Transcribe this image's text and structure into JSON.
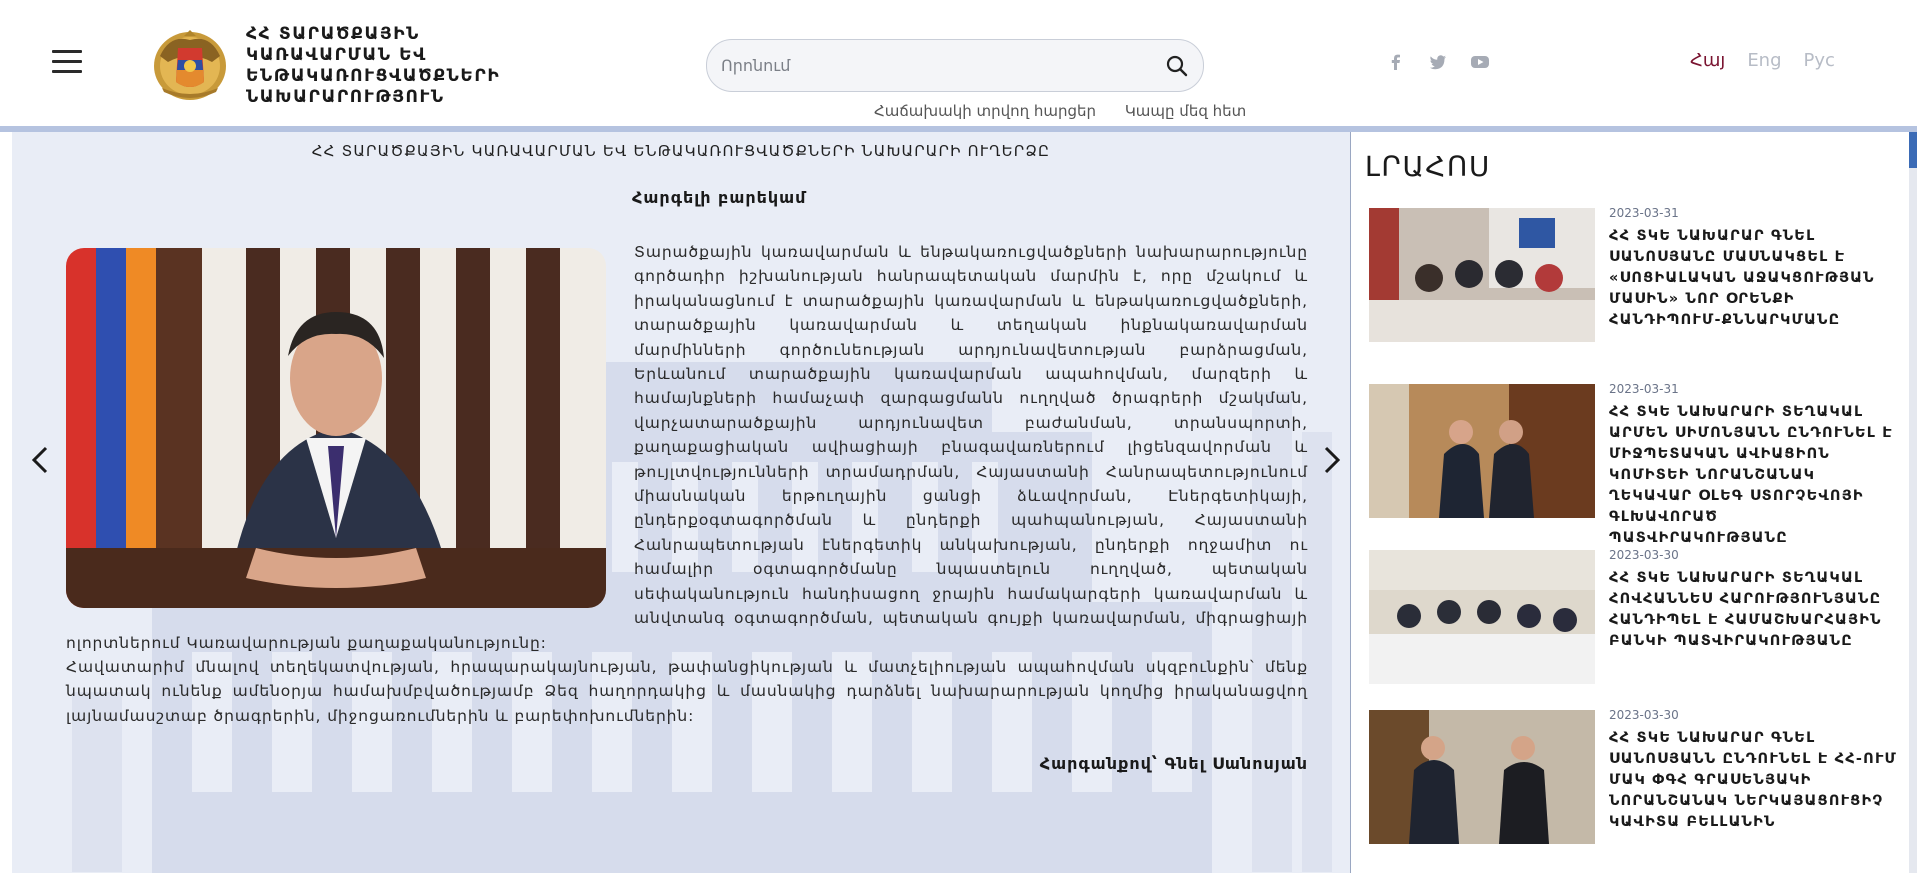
{
  "header": {
    "ministry_title": "ՀՀ ՏԱՐԱԾՔԱՅԻՆ ԿԱՌԱՎԱՐՄԱՆ ԵՎ ԵՆԹԱԿԱՌՈՒՑՎԱԾՔՆԵՐԻ ՆԱԽԱՐԱՐՈՒԹՅՈՒՆ",
    "search_placeholder": "Որոնում",
    "links": {
      "faq": "Հաճախակի տրվող հարցեր",
      "contact": "Կապը մեզ հետ"
    },
    "social_icons": [
      "facebook-icon",
      "twitter-icon",
      "youtube-icon"
    ],
    "languages": [
      {
        "label": "Հայ",
        "active": true
      },
      {
        "label": "Eng",
        "active": false
      },
      {
        "label": "Рус",
        "active": false
      }
    ]
  },
  "main": {
    "title": "ՀՀ ՏԱՐԱԾՔԱՅԻՆ ԿԱՌԱՎԱՐՄԱՆ ԵՎ ԵՆԹԱԿԱՌՈՒՑՎԱԾՔՆԵՐԻ ՆԱԽԱՐԱՐԻ ՈՒՂԵՐՁԸ",
    "greeting": "Հարգելի բարեկամ",
    "paragraph1": "Տարածքային կառավարման և ենթակառուցվածքների նախարարությունը գործադիր իշխանության հանրապետական մարմին է, որը մշակում և իրականացնում է տարածքային կառավարման և ենթակառուցվածքների, տարածքային կառավարման և տեղական ինքնակառավարման մարմինների գործունեության արդյունավետության բարձրացման, Երևանում տարածքային կառավարման ապահովման, մարզերի և համայնքների համաչափ զարգացմանն ուղղված ծրագրերի մշակման, վարչատարածքային արդյունավետ բաժանման, տրանսպորտի, քաղաքացիական ավիացիայի բնագավառներում լիցենզավորման և թույլտվությունների տրամադրման, Հայաստանի Հանրապետությունում միասնական երթուղային ցանցի ձևավորման, Էներգետիկայի, ընդերքօգտագործման և ընդերքի պահպանության, Հայաստանի Հանրապետության էներգետիկ անկախության, ընդերքի ողջամիտ ու համալիր օգտագործմանը նպաստելուն ուղղված, պետական սեփականություն հանդիսացող ջրային համակարգերի կառավարման և անվտանգ օգտագործման, պետական գույքի կառավարման, միգրացիայի ոլորտներում Կառավարության քաղաքականությունը:",
    "paragraph2": "Հավատարիմ մնալով տեղեկատվության, հրապարակայնության, թափանցիկության և մատչելիության ապահովման սկզբունքին՝ մենք նպատակ ունենք ամենօրյա համախմբվածությամբ Ձեզ հաղորդակից և մասնակից դարձնել նախարարության կողմից իրականացվող լայնամասշտաբ ծրագրերին, միջոցառումներին և բարեփոխումներին:",
    "signature": "Հարգանքով՝ Գնել Սանոսյան"
  },
  "news": {
    "title": "ԼՐԱՀՈՍ",
    "items": [
      {
        "date": "2023-03-31",
        "headline": "ՀՀ ՏԿԵ ՆԱԽԱՐԱՐ ԳՆԵԼ ՍԱՆՈՍՅԱՆԸ ՄԱՍՆԱԿՑԵԼ Է «ՍՈՑԻԱԼԱԿԱՆ ԱՋԱԿՑՈՒԹՅԱՆ ՄԱՍԻՆ» ՆՈՐ ՕՐԵՆՔԻ ՀԱՆԴԻՊՈՒՄ-ՔՆՆԱՐԿՄԱՆԸ"
      },
      {
        "date": "2023-03-31",
        "headline": "ՀՀ ՏԿԵ ՆԱԽԱՐԱՐԻ ՏԵՂԱԿԱԼ ԱՐՄԵՆ ՍԻՄՈՆՅԱՆՆ ԸՆԴՈՒՆԵԼ Է ՄԻՋՊԵՏԱԿԱՆ ԱՎԻԱՑԻՈՆ ԿՈՄԻՏԵԻ ՆՈՐԱՆՇԱՆԱԿ ՂԵԿԱՎԱՐ ՕԼԵԳ ՍՏՈՐՉԵՎՈՅԻ ԳԼԽԱՎՈՐԱԾ ՊԱՏՎԻՐԱԿՈՒԹՅԱՆԸ"
      },
      {
        "date": "2023-03-30",
        "headline": "ՀՀ ՏԿԵ ՆԱԽԱՐԱՐԻ ՏԵՂԱԿԱԼ ՀՈՎՀԱՆՆԵՍ ՀԱՐՈՒԹՅՈՒՆՅԱՆԸ ՀԱՆԴԻՊԵԼ Է ՀԱՄԱՇԽԱՐՀԱՅԻՆ ԲԱՆԿԻ ՊԱՏՎԻՐԱԿՈՒԹՅԱՆԸ"
      },
      {
        "date": "2023-03-30",
        "headline": "ՀՀ ՏԿԵ ՆԱԽԱՐԱՐ ԳՆԵԼ ՍԱՆՈՍՅԱՆՆ ԸՆԴՈՒՆԵԼ Է ՀՀ-ՈՒՄ ՄԱԿ ՓԳՀ ԳՐԱՍԵՆՅԱԿԻ ՆՈՐԱՆՇԱՆԱԿ ՆԵՐԿԱՅԱՑՈՒՑԻՉ ԿԱՎԻՏԱ ԲԵԼԼԱՆԻՆ"
      }
    ]
  },
  "colors": {
    "accent": "#7a1330",
    "band": "#b5c3e0",
    "main_bg": "#e9edf6",
    "scroll_thumb": "#3b6bb6"
  }
}
